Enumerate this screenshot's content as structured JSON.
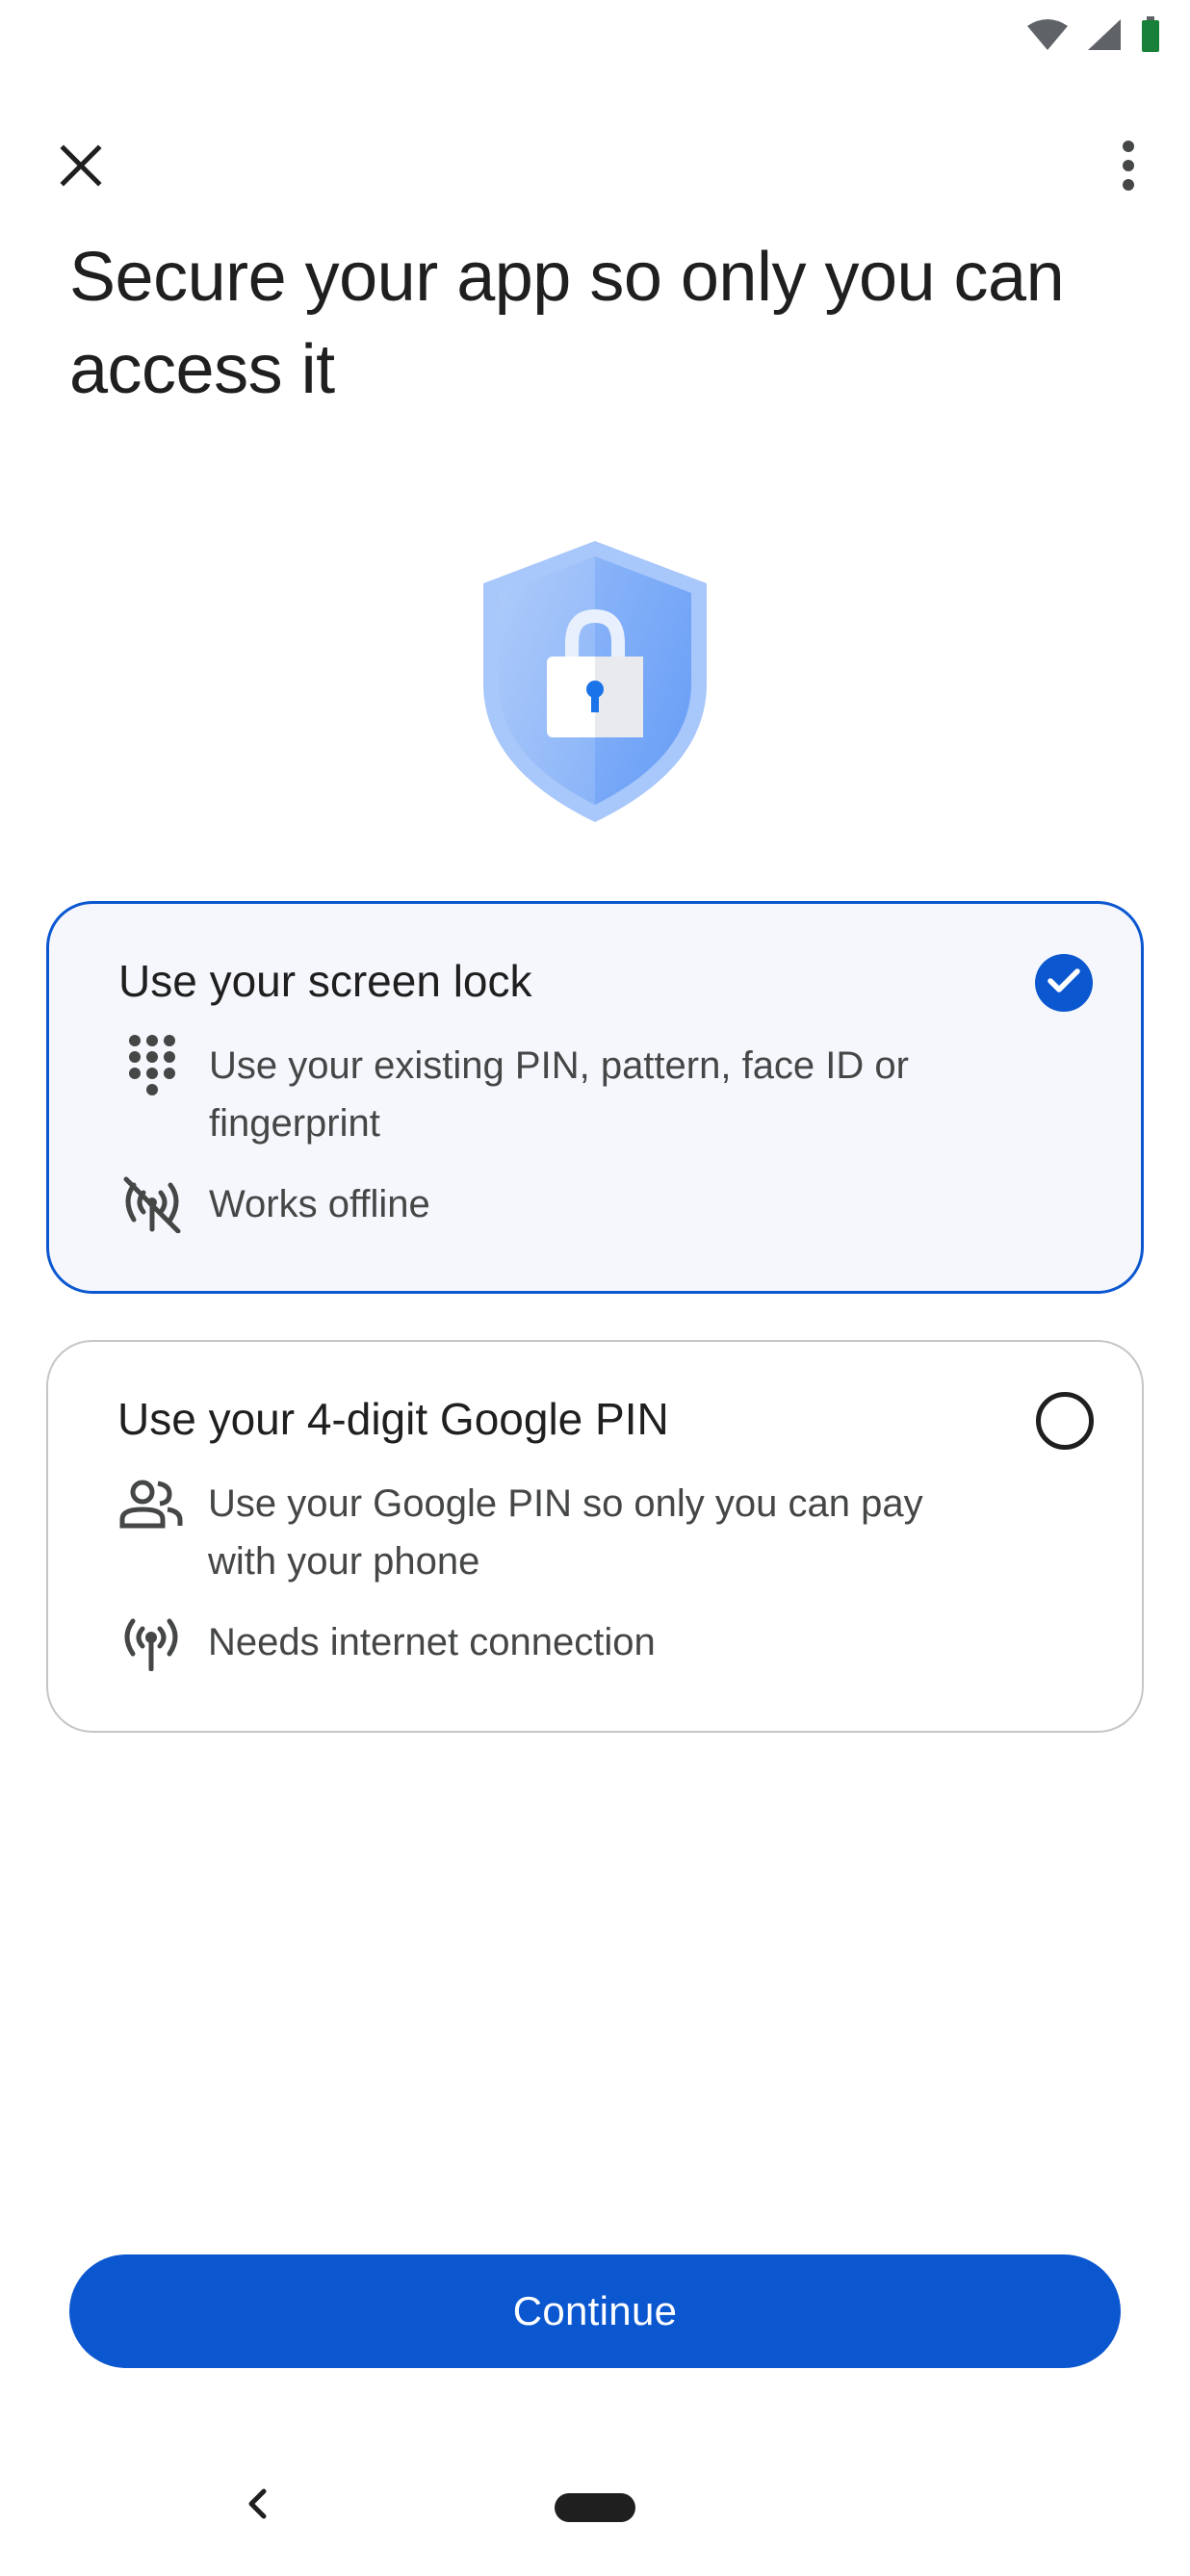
{
  "status_bar": {
    "icons": [
      "wifi-icon",
      "cellular-signal-icon",
      "battery-icon"
    ],
    "battery_color": "#188038"
  },
  "top_bar": {
    "close_icon": "close-icon",
    "menu_icon": "more-vert-icon"
  },
  "title": "Secure your app so only you can access it",
  "hero_icon": "shield-lock-icon",
  "options": [
    {
      "title": "Use your screen lock",
      "selected": true,
      "features": [
        {
          "icon": "dialpad-icon",
          "text": "Use your existing PIN, pattern, face ID or fingerprint"
        },
        {
          "icon": "offline-signal-icon",
          "text": "Works offline"
        }
      ]
    },
    {
      "title": "Use your 4-digit Google PIN",
      "selected": false,
      "features": [
        {
          "icon": "people-icon",
          "text": "Use your Google PIN so only you can pay with your phone"
        },
        {
          "icon": "antenna-icon",
          "text": "Needs internet connection"
        }
      ]
    }
  ],
  "continue_label": "Continue",
  "colors": {
    "accent": "#0b57d0",
    "selected_card_bg": "#f5f7fc",
    "text_primary": "#1f1f1f",
    "text_secondary": "#444746"
  }
}
